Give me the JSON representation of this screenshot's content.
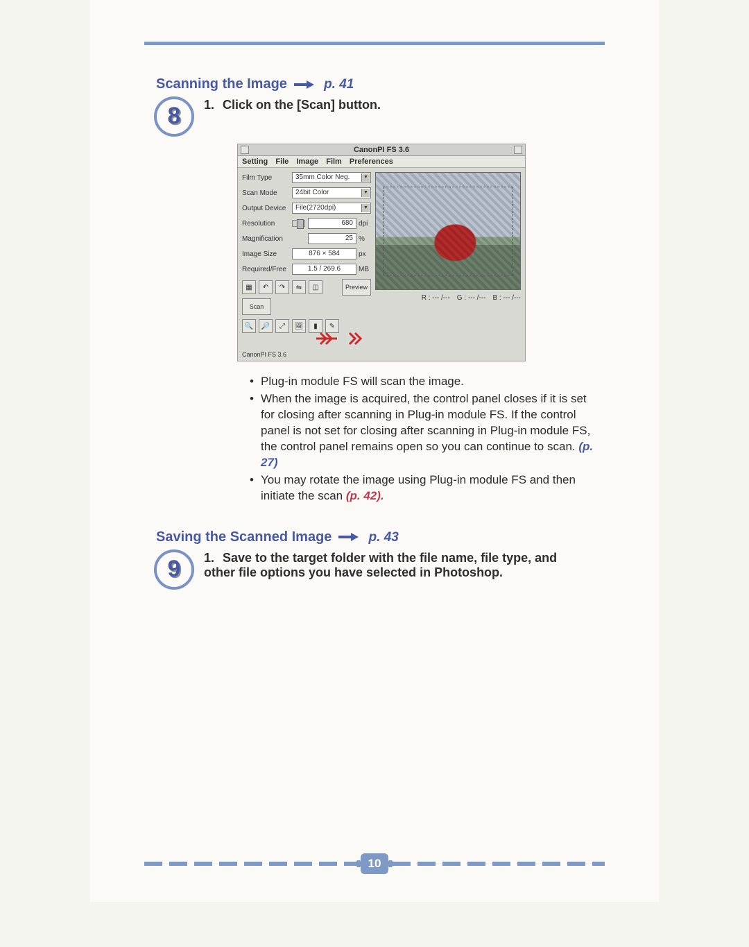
{
  "page_number": "10",
  "sections": [
    {
      "step_number": "8",
      "title": "Scanning the Image",
      "page_ref": "p. 41",
      "instruction": "Click on the [Scan] button.",
      "bullets": [
        {
          "text": "Plug-in module FS will scan the image."
        },
        {
          "text": "When the image is acquired, the control panel closes if it is set for closing after scanning in Plug-in module FS.  If the control panel is not set for closing after scanning in Plug-in module FS, the control panel remains open so you can continue to scan.  ",
          "ref": "(p. 27)",
          "ref_style": "blue"
        },
        {
          "text": "You may rotate the image using Plug-in module FS and then initiate the scan ",
          "ref": "(p. 42).",
          "ref_style": "red"
        }
      ]
    },
    {
      "step_number": "9",
      "title": "Saving the Scanned Image",
      "page_ref": "p. 43",
      "instruction": "Save to the target folder with the file name, file type, and other file options you have selected in Photoshop."
    }
  ],
  "screenshot": {
    "title": "CanonPI FS 3.6",
    "menus": [
      "Setting",
      "File",
      "Image",
      "Film",
      "Preferences"
    ],
    "fields": {
      "film_type": {
        "label": "Film Type",
        "value": "35mm Color Neg."
      },
      "scan_mode": {
        "label": "Scan Mode",
        "value": "24bit Color"
      },
      "output_device": {
        "label": "Output Device",
        "value": "File(2720dpi)"
      },
      "resolution": {
        "label": "Resolution",
        "value": "680",
        "unit": "dpi"
      },
      "magnification": {
        "label": "Magnification",
        "value": "25",
        "unit": "%"
      },
      "image_size": {
        "label": "Image Size",
        "value": "876 × 584",
        "unit": "px"
      },
      "required_free": {
        "label": "Required/Free",
        "value": "1.5 / 269.6",
        "unit": "MB"
      }
    },
    "buttons": {
      "preview": "Preview",
      "scan": "Scan"
    },
    "footer_left": "CanonPI FS 3.6",
    "rgb": {
      "r": "R : --- /---",
      "g": "G : --- /---",
      "b": "B : --- /---"
    }
  }
}
